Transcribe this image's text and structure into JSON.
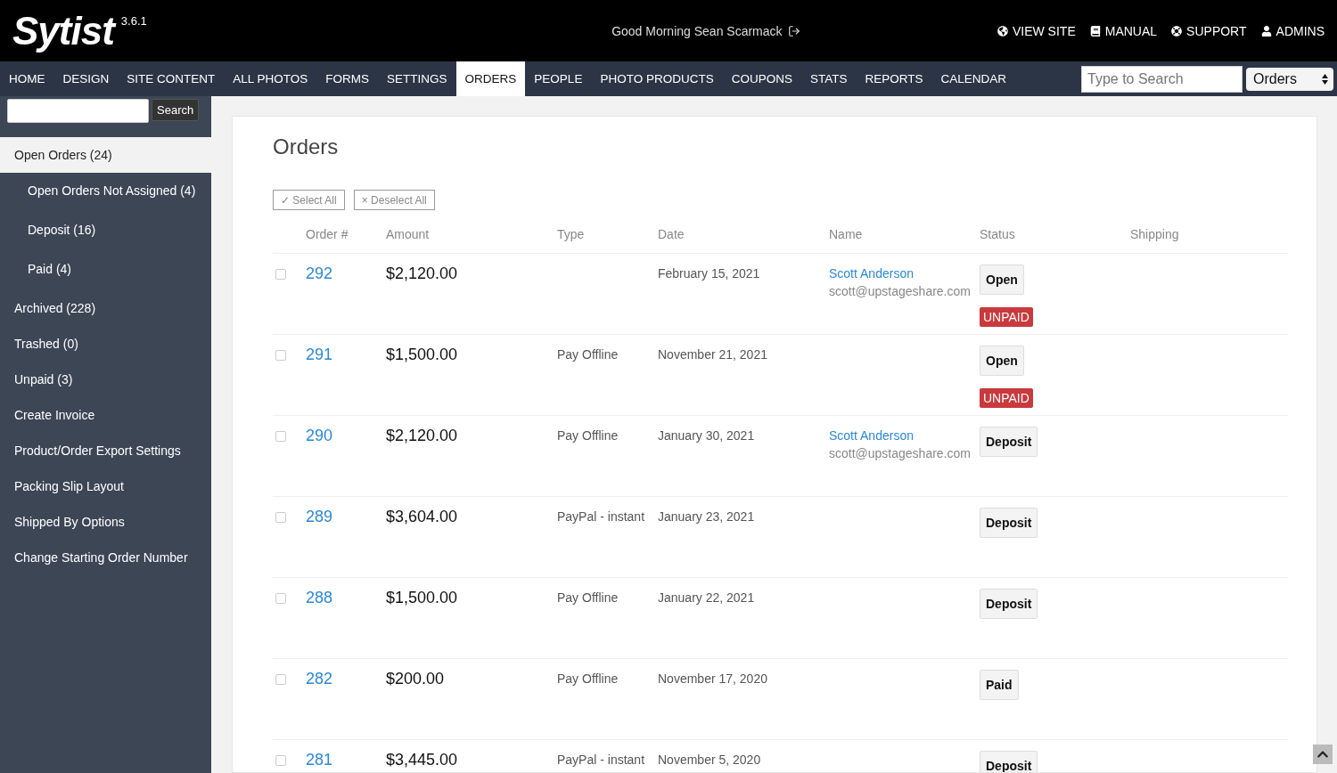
{
  "header": {
    "logo": "Sytist",
    "version": "3.6.1",
    "greeting": "Good Morning Sean Scarmack",
    "links": [
      {
        "kind": "globe",
        "label": "VIEW SITE"
      },
      {
        "kind": "book",
        "label": "MANUAL"
      },
      {
        "kind": "lifebuoy",
        "label": "SUPPORT"
      },
      {
        "kind": "user",
        "label": "ADMINS"
      }
    ]
  },
  "nav": {
    "tabs": [
      {
        "label": "HOME",
        "selected": false
      },
      {
        "label": "DESIGN",
        "selected": false
      },
      {
        "label": "SITE CONTENT",
        "selected": false
      },
      {
        "label": "ALL PHOTOS",
        "selected": false
      },
      {
        "label": "FORMS",
        "selected": false
      },
      {
        "label": "SETTINGS",
        "selected": false
      },
      {
        "label": "ORDERS",
        "selected": true
      },
      {
        "label": "PEOPLE",
        "selected": false
      },
      {
        "label": "PHOTO PRODUCTS",
        "selected": false
      },
      {
        "label": "COUPONS",
        "selected": false
      },
      {
        "label": "STATS",
        "selected": false
      },
      {
        "label": "REPORTS",
        "selected": false
      },
      {
        "label": "CALENDAR",
        "selected": false
      }
    ],
    "search": {
      "placeholder": "Type to Search"
    },
    "scope": "Orders"
  },
  "sidebar": {
    "search_button": "Search",
    "items": [
      {
        "label": "Open Orders (24)",
        "selected": true,
        "children": [
          {
            "label": "Open Orders Not Assigned (4)",
            "selected": false
          },
          {
            "label": "Deposit (16)",
            "selected": false
          },
          {
            "label": "Paid (4)",
            "selected": false
          }
        ]
      },
      {
        "label": "Archived (228)",
        "selected": false
      },
      {
        "label": "Trashed (0)",
        "selected": false
      },
      {
        "label": "Unpaid (3)",
        "selected": false
      },
      {
        "label": "Create Invoice",
        "selected": false
      },
      {
        "label": "Product/Order Export Settings",
        "selected": false
      },
      {
        "label": "Packing Slip Layout",
        "selected": false
      },
      {
        "label": "Shipped By Options",
        "selected": false
      },
      {
        "label": "Change Starting Order Number",
        "selected": false
      }
    ]
  },
  "page": {
    "title": "Orders",
    "select_all": "Select All",
    "deselect_all": "Deselect All",
    "select_icon": "✓",
    "deselect_icon": "×"
  },
  "table": {
    "columns": [
      "Order #",
      "Amount",
      "Type",
      "Date",
      "Name",
      "Status",
      "Shipping"
    ],
    "rows": [
      {
        "checked": false,
        "order": "292",
        "amount": "$2,120.00",
        "type": "",
        "date": "February 15, 2021",
        "name": "Scott Anderson",
        "email": "scott@upstageshare.com",
        "status": "Open",
        "payment": "UNPAID"
      },
      {
        "checked": false,
        "order": "291",
        "amount": "$1,500.00",
        "type": "Pay Offline",
        "date": "November 21, 2021",
        "name": "",
        "email": "",
        "status": "Open",
        "payment": "UNPAID"
      },
      {
        "checked": false,
        "order": "290",
        "amount": "$2,120.00",
        "type": "Pay Offline",
        "date": "January 30, 2021",
        "name": "Scott Anderson",
        "email": "scott@upstageshare.com",
        "status": "Deposit",
        "payment": ""
      },
      {
        "checked": false,
        "order": "289",
        "amount": "$3,604.00",
        "type": "PayPal - instant",
        "date": "January 23, 2021",
        "name": "",
        "email": "",
        "status": "Deposit",
        "payment": ""
      },
      {
        "checked": false,
        "order": "288",
        "amount": "$1,500.00",
        "type": "Pay Offline",
        "date": "January 22, 2021",
        "name": "",
        "email": "",
        "status": "Deposit",
        "payment": ""
      },
      {
        "checked": false,
        "order": "282",
        "amount": "$200.00",
        "type": "Pay Offline",
        "date": "November 17, 2020",
        "name": "",
        "email": "",
        "status": "Paid",
        "payment": ""
      },
      {
        "checked": false,
        "order": "281",
        "amount": "$3,445.00",
        "type": "PayPal - instant",
        "date": "November 5, 2020",
        "name": "",
        "email": "",
        "status": "Deposit",
        "payment": ""
      }
    ]
  }
}
